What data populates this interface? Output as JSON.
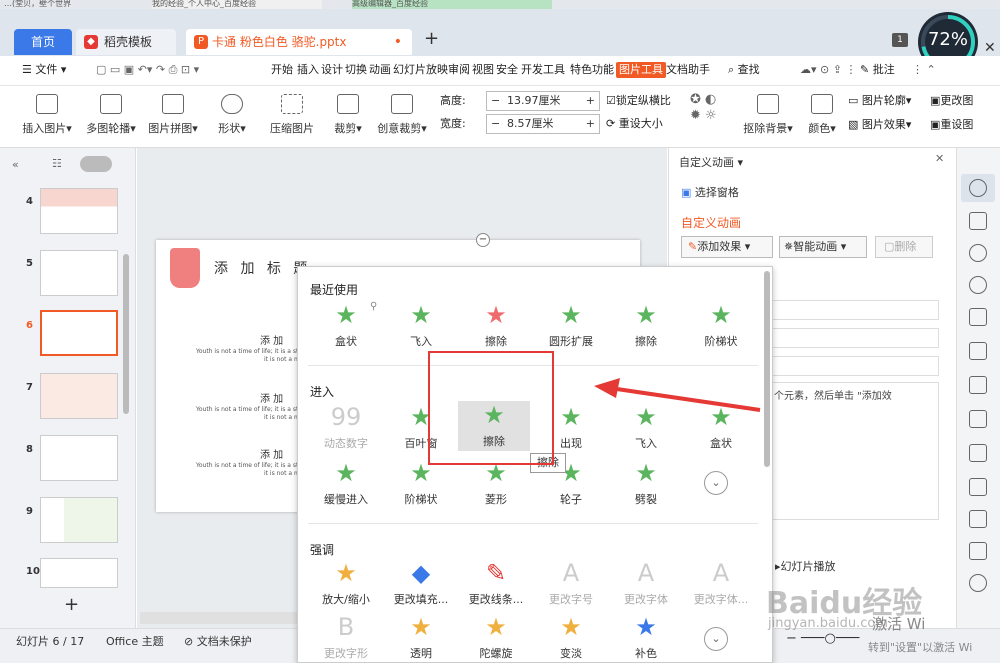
{
  "browser": {
    "tabs": [
      "…(堂贝，壁个世界",
      "我的经验_个人中心_百度经验",
      "高级编辑器_百度经验"
    ]
  },
  "tabs": {
    "home": "首页",
    "template": "稻壳模板",
    "doc": "卡通 粉色白色 骆驼.pptx",
    "add": "+",
    "badge": "1"
  },
  "progress": {
    "label": "72%",
    "value": 72
  },
  "menu": {
    "file": "文件",
    "items": [
      "开始",
      "插入",
      "设计",
      "切换",
      "动画",
      "幻灯片放映",
      "审阅",
      "视图",
      "安全",
      "开发工具",
      "特色功能",
      "图片工具",
      "文档助手"
    ],
    "active": "图片工具",
    "search": "查找",
    "comment": "批注"
  },
  "ribbon": {
    "insert_pic": "插入图片",
    "multi_carousel": "多图轮播",
    "pic_collage": "图片拼图",
    "shape": "形状",
    "compress": "压缩图片",
    "crop": "裁剪",
    "creative_crop": "创意裁剪",
    "height_label": "高度:",
    "height": "13.97厘米",
    "width_label": "宽度:",
    "width": "8.57厘米",
    "lock_ratio": "锁定纵横比",
    "resize": "重设大小",
    "remove_bg": "抠除背景",
    "color": "颜色",
    "outline": "图片轮廓",
    "effects": "图片效果",
    "change_pic": "更改图",
    "reset": "重设图"
  },
  "slides": {
    "numbers": [
      "4",
      "5",
      "6",
      "7",
      "8",
      "9",
      "10"
    ],
    "add": "+"
  },
  "slide": {
    "title": "添 加 标 题",
    "heading": "添 加",
    "body1": "Youth is not a time of life; it is a stat",
    "body2": "it is not a matter of r"
  },
  "rightpane": {
    "title": "自定义动画",
    "selection": "选择窗格",
    "section": "自定义动画",
    "add_effect": "添加效果",
    "smart": "智能动画",
    "delete": "删除",
    "hint": "个元素，然后单击 \"添加效",
    "play": "幻灯片播放"
  },
  "status": {
    "slide": "幻灯片 6 / 17",
    "theme": "Office 主题",
    "protect": "文档未保护",
    "activate1": "激活 Wi",
    "activate2": "转到\"设置\"以激活 Wi"
  },
  "effects": {
    "recent_label": "最近使用",
    "recent": [
      "盒状",
      "飞入",
      "擦除",
      "圆形扩展",
      "擦除",
      "阶梯状"
    ],
    "enter_label": "进入",
    "enter_row1": [
      "动态数字",
      "百叶窗",
      "擦除",
      "出现",
      "飞入",
      "盒状"
    ],
    "enter_row2": [
      "缓慢进入",
      "阶梯状",
      "菱形",
      "轮子",
      "劈裂"
    ],
    "tooltip": "擦除",
    "emph_label": "强调",
    "emph_row1": [
      "放大/缩小",
      "更改填充...",
      "更改线条...",
      "更改字号",
      "更改字体",
      "更改字体..."
    ],
    "emph_row2": [
      "更改字形",
      "透明",
      "陀螺旋",
      "变淡",
      "补色"
    ]
  },
  "watermark": "Baidu经验",
  "watermark_url": "jingyan.baidu.com",
  "colors": {
    "accent": "#3b79e8",
    "wps_orange": "#f15a24",
    "highlight": "#e53935",
    "star": "#5ab55e"
  }
}
